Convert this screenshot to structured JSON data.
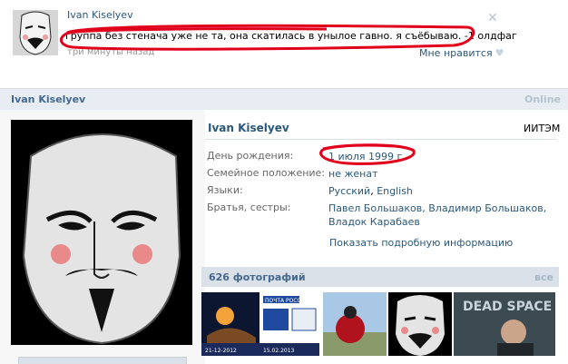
{
  "post": {
    "author": "Ivan Kiselyev",
    "text": "группа без стенача уже не та, она скатилась в унылое гавно. я съёбываю. -1 олдфаг",
    "time": "три минуты назад",
    "like_label": "Мне нравится",
    "like_icon": "heart-icon",
    "close_icon": "close-icon"
  },
  "profile": {
    "header_name": "Ivan Kiselyev",
    "online": "Online",
    "name": "Ivan Kiselyev",
    "status": "ИИТЭМ",
    "rows": [
      {
        "label": "День рождения:",
        "value": "1 июля 1999 г."
      },
      {
        "label": "Семейное положение:",
        "value": "не женат"
      },
      {
        "label": "Языки:",
        "value_parts": [
          "Русский",
          ", ",
          "English"
        ]
      },
      {
        "label": "Братья, сестры:",
        "value": "Павел Большаков, Владимир Большаков, Владок Карабаев"
      }
    ],
    "more_link": "Показать подробную информацию"
  },
  "photos": {
    "title": "626 фотографий",
    "all": "все",
    "thumbs": [
      {
        "caption_top": "",
        "caption_bottom": "ДОСТАВИЛА",
        "date_left": "21-12-2012",
        "date_right": "15.02.2013"
      },
      {
        "caption_top": "ПОЧТА РОССИИ"
      },
      {
        "caption_top": ""
      },
      {
        "caption_top": ""
      },
      {
        "caption_top": "DEAD SPACE"
      }
    ]
  },
  "colors": {
    "link": "#2b587a",
    "header_bg": "#e7edf2",
    "scribble": "#e0001b"
  }
}
